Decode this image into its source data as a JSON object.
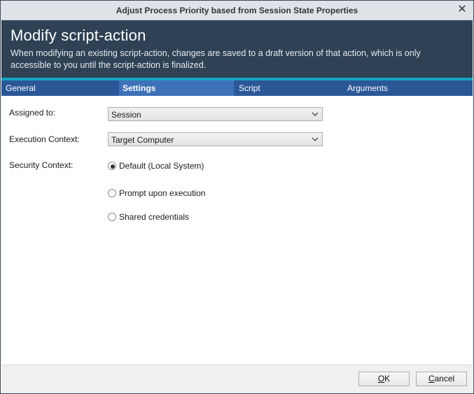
{
  "window": {
    "title": "Adjust Process Priority based from Session State Properties",
    "close_glyph": "✕"
  },
  "header": {
    "title": "Modify script-action",
    "description": "When modifying an existing script-action, changes are saved to a draft version of that action, which is only accessible to you until the script-action is finalized.",
    "background": "#2f4154",
    "accent": "#17a5c2"
  },
  "tabs": [
    {
      "label": "General",
      "active": false
    },
    {
      "label": "Settings",
      "active": true
    },
    {
      "label": "Script",
      "active": false
    },
    {
      "label": "Arguments",
      "active": false
    }
  ],
  "tab_bar_color": "#2b5797",
  "form": {
    "assigned_to": {
      "label": "Assigned to:",
      "value": "Session"
    },
    "execution_context": {
      "label": "Execution Context:",
      "value": "Target Computer"
    },
    "security_context": {
      "label": "Security Context:",
      "options": [
        {
          "label": "Default (Local System)",
          "selected": true
        },
        {
          "label": "Prompt upon execution",
          "selected": false
        },
        {
          "label": "Shared credentials",
          "selected": false
        }
      ]
    }
  },
  "footer": {
    "ok_label": "OK",
    "cancel_label": "Cancel"
  }
}
